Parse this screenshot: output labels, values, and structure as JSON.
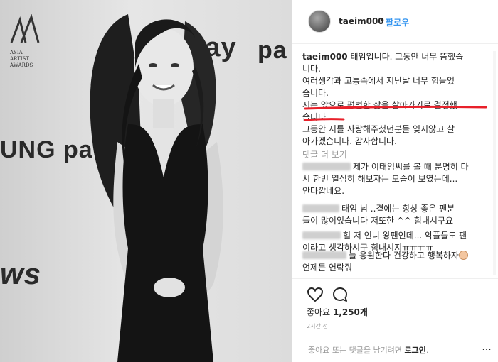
{
  "photo": {
    "brand_top": "gpay",
    "brand_mid": "UNG pa",
    "brand_news": "ws",
    "brand_right": "pa",
    "aaa_line1": "ASIA",
    "aaa_line2": "ARTIST",
    "aaa_line3": "AWARDS"
  },
  "header": {
    "username": "taeim000",
    "dot": "•",
    "follow_label": "팔로우"
  },
  "caption": {
    "username": "taeim000",
    "lines": [
      " 태임입니다. 그동안 너무 뜸했습",
      "니다.",
      "여러생각과 고통속에서 지난날 너무 힘들었",
      "습니다.",
      "저는 앞으로 평범한 삶을 살아가기로 결정했",
      "습니다.",
      "그동안 저를 사랑해주셨던분들 잊지않고 살",
      "아가겠습니다. 감사합니다."
    ],
    "underline_color": "#e8202a"
  },
  "more_comments": "댓글 더 보기",
  "comments": [
    {
      "lines": [
        "제가 이태임씨를 볼 때 분명히 다",
        "시 한번 열심히 해보자는 모습이 보였는데...",
        "안타깝네요."
      ]
    },
    {
      "lines": [
        "태임 님 ..곁에는 항상 좋은 팬분",
        "들이 많이있습니다 저또한 ^^ 힘내시구요"
      ]
    },
    {
      "lines": [
        "헐 저 언니 왕팬인데... 악플들도 팬",
        "이라고 생각하시구 힘내시지ㅠㅠㅠㅠ"
      ]
    },
    {
      "lines": [
        "늘 응원한다 건강하고 행복하자",
        "언제든 연락줘"
      ]
    }
  ],
  "likes": {
    "prefix": "좋아요 ",
    "count": "1,250개"
  },
  "time_ago": "2시간 전",
  "login_bar": {
    "text": "좋아요 또는 댓글을 남기려면 ",
    "link": "로그인",
    "suffix": ".",
    "more": "..."
  },
  "icons": {
    "like": "heart-icon",
    "comment": "comment-bubble-icon",
    "avatar": "avatar"
  }
}
